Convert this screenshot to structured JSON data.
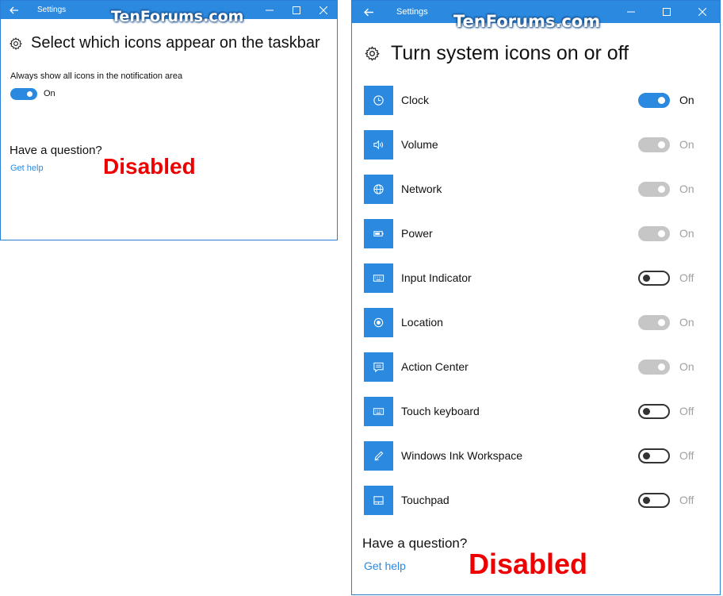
{
  "watermark": "TenForums.com",
  "left_window": {
    "titlebar": {
      "title": "Settings"
    },
    "heading": "Select which icons appear on the taskbar",
    "always_show": {
      "label": "Always show all icons in the notification area",
      "state": "On"
    },
    "question": "Have a question?",
    "get_help": "Get help",
    "note": "Disabled"
  },
  "right_window": {
    "titlebar": {
      "title": "Settings"
    },
    "heading": "Turn system icons on or off",
    "items": [
      {
        "label": "Clock",
        "icon": "clock-icon",
        "state": "On",
        "toggle": "on"
      },
      {
        "label": "Volume",
        "icon": "volume-icon",
        "state": "On",
        "toggle": "dim"
      },
      {
        "label": "Network",
        "icon": "network-icon",
        "state": "On",
        "toggle": "dim"
      },
      {
        "label": "Power",
        "icon": "power-icon",
        "state": "On",
        "toggle": "dim"
      },
      {
        "label": "Input Indicator",
        "icon": "keyboard-icon",
        "state": "Off",
        "toggle": "off"
      },
      {
        "label": "Location",
        "icon": "location-icon",
        "state": "On",
        "toggle": "dim"
      },
      {
        "label": "Action Center",
        "icon": "action-center-icon",
        "state": "On",
        "toggle": "dim"
      },
      {
        "label": "Touch keyboard",
        "icon": "keyboard-icon",
        "state": "Off",
        "toggle": "off"
      },
      {
        "label": "Windows Ink Workspace",
        "icon": "pen-icon",
        "state": "Off",
        "toggle": "off"
      },
      {
        "label": "Touchpad",
        "icon": "touchpad-icon",
        "state": "Off",
        "toggle": "off"
      }
    ],
    "question": "Have a question?",
    "get_help": "Get help",
    "note": "Disabled"
  },
  "colors": {
    "accent": "#2b8ae0",
    "toggle_disabled": "#c6c6c6",
    "note": "#ee0000"
  }
}
